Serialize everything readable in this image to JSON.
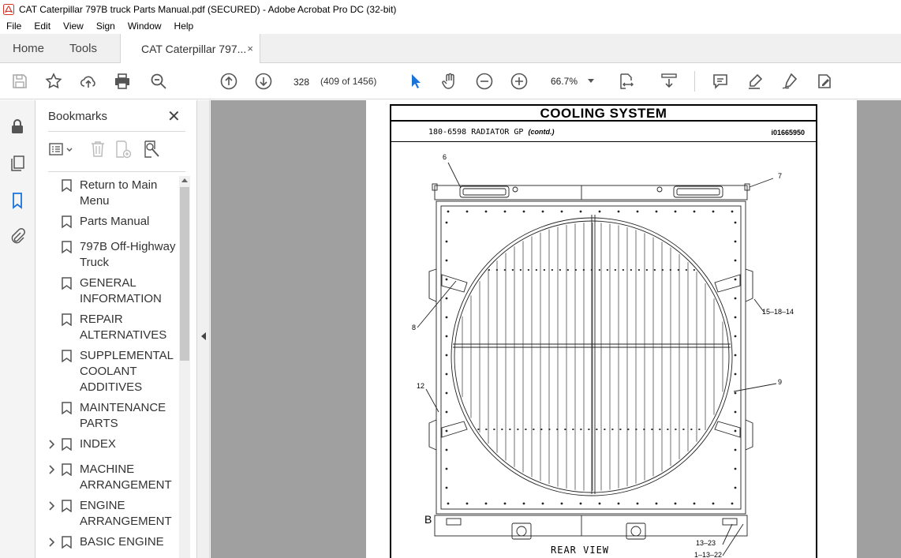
{
  "window": {
    "title": "CAT Caterpillar 797B truck Parts Manual.pdf (SECURED) - Adobe Acrobat Pro DC (32-bit)"
  },
  "menu": [
    "File",
    "Edit",
    "View",
    "Sign",
    "Window",
    "Help"
  ],
  "tabs": {
    "home": "Home",
    "tools": "Tools",
    "document": "CAT Caterpillar 797...",
    "close": "×"
  },
  "toolbar": {
    "page_number": "328",
    "page_count": "(409 of 1456)",
    "zoom": "66.7%"
  },
  "bookmarks": {
    "title": "Bookmarks",
    "close": "✕",
    "items": [
      {
        "label": "Return to Main Menu",
        "expandable": false
      },
      {
        "label": "Parts Manual",
        "expandable": false
      },
      {
        "label": "797B Off-Highway Truck",
        "expandable": false
      },
      {
        "label": "GENERAL INFORMATION",
        "expandable": false
      },
      {
        "label": "REPAIR ALTERNATIVES",
        "expandable": false
      },
      {
        "label": "SUPPLEMENTAL COOLANT ADDITIVES",
        "expandable": false
      },
      {
        "label": "MAINTENANCE PARTS",
        "expandable": false
      },
      {
        "label": "INDEX",
        "expandable": true
      },
      {
        "label": "MACHINE ARRANGEMENT",
        "expandable": true
      },
      {
        "label": "ENGINE ARRANGEMENT",
        "expandable": true
      },
      {
        "label": "BASIC ENGINE",
        "expandable": true
      }
    ]
  },
  "document": {
    "heading": "COOLING SYSTEM",
    "part_number": "180-6598",
    "part_name": "RADIATOR GP",
    "part_note": "(contd.)",
    "illustration_id": "i01665950",
    "callouts": {
      "c6": "6",
      "c7": "7",
      "c8": "8",
      "c9": "9",
      "c12": "12",
      "c15_18_14": "15–18–14",
      "c13_23": "13–23",
      "c1_13_22": "1–13–22"
    },
    "view_letter": "B",
    "view_label": "REAR VIEW"
  }
}
